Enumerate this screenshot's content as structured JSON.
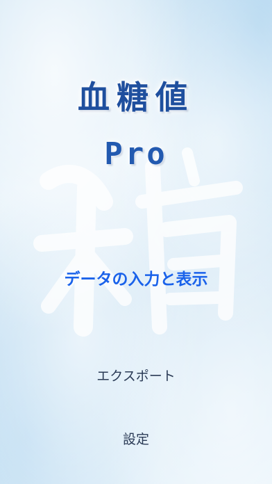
{
  "app": {
    "title": "血糖値",
    "subtitle": "Pro"
  },
  "menu": {
    "data_entry_label": "データの入力と表示",
    "export_label": "エクスポート",
    "settings_label": "設定"
  },
  "colors": {
    "title": "#1f4f9e",
    "primary_action": "#1a62ea",
    "secondary_action": "#2a3a55",
    "background": "#d6e9f6"
  }
}
